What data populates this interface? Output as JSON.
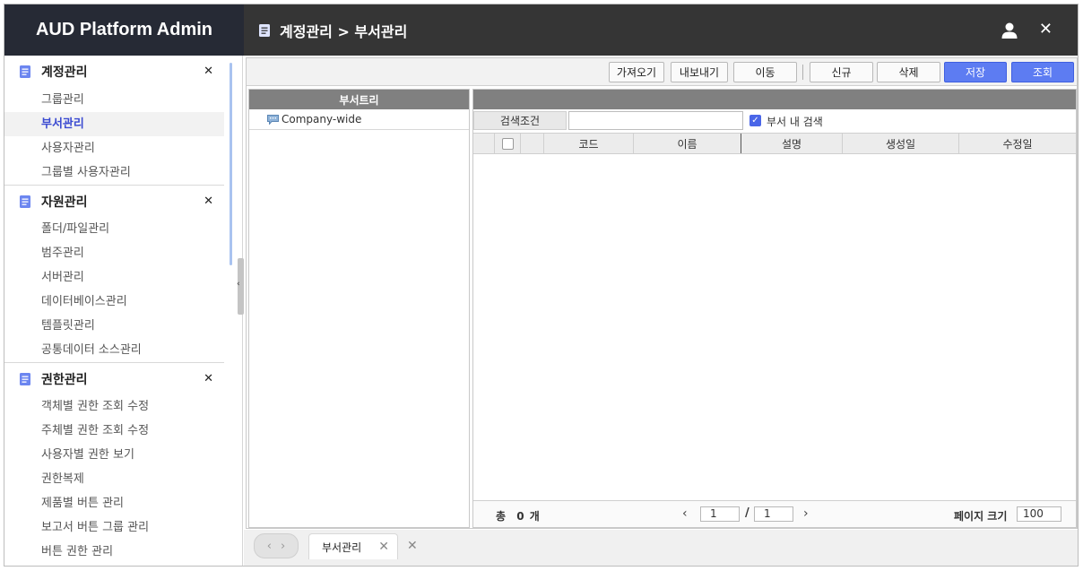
{
  "app": {
    "title": "AUD Platform Admin"
  },
  "header": {
    "breadcrumb": "계정관리 > 부서관리",
    "user_icon": "user-icon",
    "close_icon": "close-icon"
  },
  "sidebar": {
    "groups": [
      {
        "label": "계정관리",
        "items": [
          "그룹관리",
          "부서관리",
          "사용자관리",
          "그룹별 사용자관리"
        ],
        "active": "부서관리"
      },
      {
        "label": "자원관리",
        "items": [
          "폴더/파일관리",
          "범주관리",
          "서버관리",
          "데이터베이스관리",
          "템플릿관리",
          "공통데이터 소스관리"
        ]
      },
      {
        "label": "권한관리",
        "items": [
          "객체별 권한 조회 수정",
          "주체별 권한 조회 수정",
          "사용자별 권한 보기",
          "권한복제",
          "제품별 버튼 관리",
          "보고서 버튼 그룹 관리",
          "버튼 권한 관리"
        ]
      }
    ]
  },
  "toolbar": {
    "import": "가져오기",
    "export": "내보내기",
    "move": "이동",
    "new": "신규",
    "delete": "삭제",
    "save": "저장",
    "search": "조회"
  },
  "tree": {
    "header": "부서트리",
    "nodes": [
      "Company-wide"
    ]
  },
  "grid": {
    "search_label": "검색조건",
    "search_value": "",
    "within_dept_checked": true,
    "within_dept_label": "부서 내 검색",
    "columns": [
      "코드",
      "이름",
      "설명",
      "생성일",
      "수정일"
    ],
    "rows": []
  },
  "footer": {
    "total_prefix": "총",
    "total_count": "0",
    "total_suffix": "개",
    "page_current": "1",
    "page_separator": "/",
    "page_total": "1",
    "page_size_label": "페이지 크기",
    "page_size": "100"
  },
  "tabs": [
    {
      "label": "부서관리"
    }
  ],
  "colors": {
    "accent": "#5d7cf2",
    "sidebar_active": "#3b4bd1",
    "header_bg": "#353535",
    "logo_bg": "#262a35"
  }
}
